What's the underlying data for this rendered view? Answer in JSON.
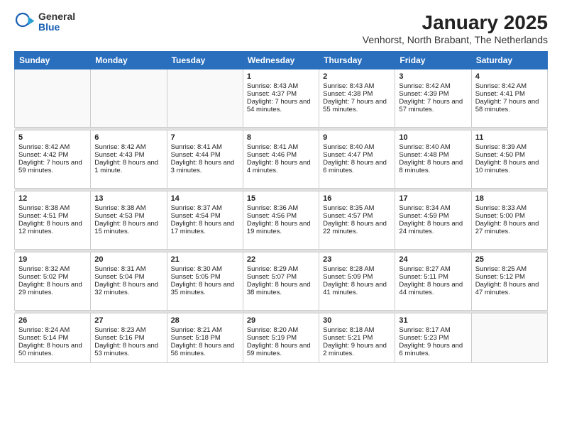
{
  "logo": {
    "general": "General",
    "blue": "Blue"
  },
  "title": "January 2025",
  "subtitle": "Venhorst, North Brabant, The Netherlands",
  "weekdays": [
    "Sunday",
    "Monday",
    "Tuesday",
    "Wednesday",
    "Thursday",
    "Friday",
    "Saturday"
  ],
  "weeks": [
    [
      {
        "day": "",
        "empty": true
      },
      {
        "day": "",
        "empty": true
      },
      {
        "day": "",
        "empty": true
      },
      {
        "day": "1",
        "sunrise": "8:43 AM",
        "sunset": "4:37 PM",
        "daylight": "7 hours and 54 minutes."
      },
      {
        "day": "2",
        "sunrise": "8:43 AM",
        "sunset": "4:38 PM",
        "daylight": "7 hours and 55 minutes."
      },
      {
        "day": "3",
        "sunrise": "8:42 AM",
        "sunset": "4:39 PM",
        "daylight": "7 hours and 57 minutes."
      },
      {
        "day": "4",
        "sunrise": "8:42 AM",
        "sunset": "4:41 PM",
        "daylight": "7 hours and 58 minutes."
      }
    ],
    [
      {
        "day": "5",
        "sunrise": "8:42 AM",
        "sunset": "4:42 PM",
        "daylight": "7 hours and 59 minutes."
      },
      {
        "day": "6",
        "sunrise": "8:42 AM",
        "sunset": "4:43 PM",
        "daylight": "8 hours and 1 minute."
      },
      {
        "day": "7",
        "sunrise": "8:41 AM",
        "sunset": "4:44 PM",
        "daylight": "8 hours and 3 minutes."
      },
      {
        "day": "8",
        "sunrise": "8:41 AM",
        "sunset": "4:46 PM",
        "daylight": "8 hours and 4 minutes."
      },
      {
        "day": "9",
        "sunrise": "8:40 AM",
        "sunset": "4:47 PM",
        "daylight": "8 hours and 6 minutes."
      },
      {
        "day": "10",
        "sunrise": "8:40 AM",
        "sunset": "4:48 PM",
        "daylight": "8 hours and 8 minutes."
      },
      {
        "day": "11",
        "sunrise": "8:39 AM",
        "sunset": "4:50 PM",
        "daylight": "8 hours and 10 minutes."
      }
    ],
    [
      {
        "day": "12",
        "sunrise": "8:38 AM",
        "sunset": "4:51 PM",
        "daylight": "8 hours and 12 minutes."
      },
      {
        "day": "13",
        "sunrise": "8:38 AM",
        "sunset": "4:53 PM",
        "daylight": "8 hours and 15 minutes."
      },
      {
        "day": "14",
        "sunrise": "8:37 AM",
        "sunset": "4:54 PM",
        "daylight": "8 hours and 17 minutes."
      },
      {
        "day": "15",
        "sunrise": "8:36 AM",
        "sunset": "4:56 PM",
        "daylight": "8 hours and 19 minutes."
      },
      {
        "day": "16",
        "sunrise": "8:35 AM",
        "sunset": "4:57 PM",
        "daylight": "8 hours and 22 minutes."
      },
      {
        "day": "17",
        "sunrise": "8:34 AM",
        "sunset": "4:59 PM",
        "daylight": "8 hours and 24 minutes."
      },
      {
        "day": "18",
        "sunrise": "8:33 AM",
        "sunset": "5:00 PM",
        "daylight": "8 hours and 27 minutes."
      }
    ],
    [
      {
        "day": "19",
        "sunrise": "8:32 AM",
        "sunset": "5:02 PM",
        "daylight": "8 hours and 29 minutes."
      },
      {
        "day": "20",
        "sunrise": "8:31 AM",
        "sunset": "5:04 PM",
        "daylight": "8 hours and 32 minutes."
      },
      {
        "day": "21",
        "sunrise": "8:30 AM",
        "sunset": "5:05 PM",
        "daylight": "8 hours and 35 minutes."
      },
      {
        "day": "22",
        "sunrise": "8:29 AM",
        "sunset": "5:07 PM",
        "daylight": "8 hours and 38 minutes."
      },
      {
        "day": "23",
        "sunrise": "8:28 AM",
        "sunset": "5:09 PM",
        "daylight": "8 hours and 41 minutes."
      },
      {
        "day": "24",
        "sunrise": "8:27 AM",
        "sunset": "5:11 PM",
        "daylight": "8 hours and 44 minutes."
      },
      {
        "day": "25",
        "sunrise": "8:25 AM",
        "sunset": "5:12 PM",
        "daylight": "8 hours and 47 minutes."
      }
    ],
    [
      {
        "day": "26",
        "sunrise": "8:24 AM",
        "sunset": "5:14 PM",
        "daylight": "8 hours and 50 minutes."
      },
      {
        "day": "27",
        "sunrise": "8:23 AM",
        "sunset": "5:16 PM",
        "daylight": "8 hours and 53 minutes."
      },
      {
        "day": "28",
        "sunrise": "8:21 AM",
        "sunset": "5:18 PM",
        "daylight": "8 hours and 56 minutes."
      },
      {
        "day": "29",
        "sunrise": "8:20 AM",
        "sunset": "5:19 PM",
        "daylight": "8 hours and 59 minutes."
      },
      {
        "day": "30",
        "sunrise": "8:18 AM",
        "sunset": "5:21 PM",
        "daylight": "9 hours and 2 minutes."
      },
      {
        "day": "31",
        "sunrise": "8:17 AM",
        "sunset": "5:23 PM",
        "daylight": "9 hours and 6 minutes."
      },
      {
        "day": "",
        "empty": true
      }
    ]
  ]
}
